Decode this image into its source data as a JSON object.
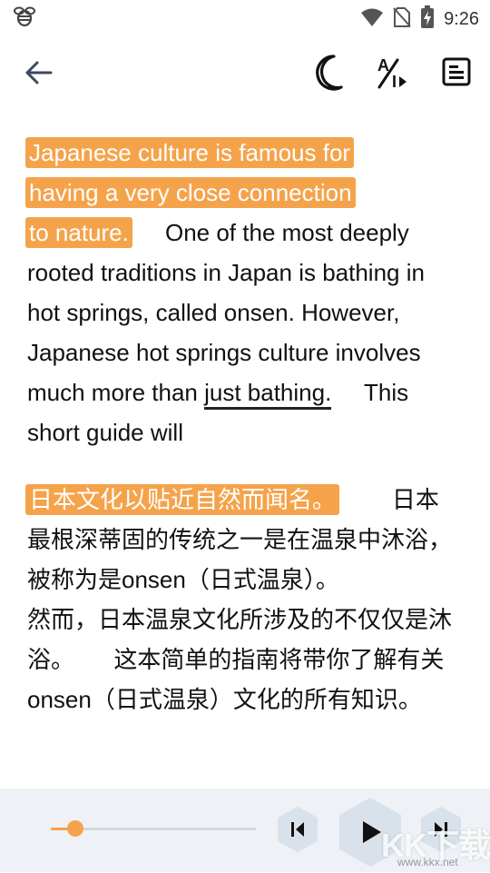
{
  "status_bar": {
    "time": "9:26",
    "icons": [
      "bee-icon",
      "wifi-icon",
      "no-sim-icon",
      "battery-charging-icon"
    ]
  },
  "toolbar": {
    "icons": [
      "back-arrow-icon",
      "moon-icon",
      "translate-icon",
      "article-icon"
    ]
  },
  "english": {
    "highlighted": [
      "Japanese culture is famous for",
      "having a very close connection",
      "to nature."
    ],
    "sentence_2": "One of the most deeply rooted traditions in Japan is bathing in hot springs, called onsen. However, Japanese hot springs culture involves much more than",
    "underlined": "just bathing.",
    "sentence_3": "This short guide will"
  },
  "chinese": {
    "highlighted": "日本文化以贴近自然而闻名。",
    "sentence_2": "日本最根深蒂固的传统之一是在温泉中沐浴，被称为是onsen（日式温泉）。",
    "sentence_2b": "然而，日本温泉文化所涉及的不仅仅是沐浴。",
    "sentence_3": "这本简单的指南将带你了解有关onsen（日式温泉）文化的所有知识。"
  },
  "player": {
    "progress": 0.12,
    "accent_color": "#f5a34b",
    "icons": [
      "previous-sentence-icon",
      "play-icon",
      "next-sentence-icon"
    ]
  },
  "watermark": {
    "text": "KK下载",
    "url": "www.kkx.net"
  }
}
